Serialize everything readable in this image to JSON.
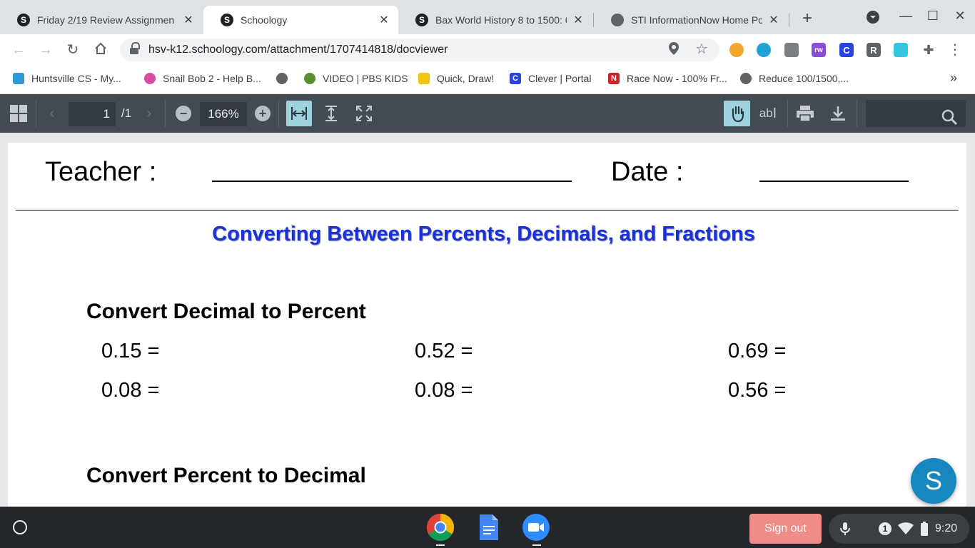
{
  "tabs": [
    {
      "title": "Friday 2/19 Review Assignmen",
      "favicon": "S",
      "active": false
    },
    {
      "title": "Schoology",
      "favicon": "S",
      "active": true
    },
    {
      "title": "Bax World History 8 to 1500: 0",
      "favicon": "S",
      "active": false
    },
    {
      "title": "STI InformationNow Home Por",
      "favicon": "globe",
      "active": false
    }
  ],
  "omnibox": {
    "url": "hsv-k12.schoology.com/attachment/1707414818/docviewer"
  },
  "extensions": [
    {
      "label": "",
      "color": "#f4a52c"
    },
    {
      "label": "",
      "color": "#1ea2d3"
    },
    {
      "label": "",
      "color": "#7b7f84"
    },
    {
      "label": "rw",
      "color": "#8a4fd6"
    },
    {
      "label": "C",
      "color": "#2a44e0"
    },
    {
      "label": "R",
      "color": "#5f6368"
    },
    {
      "label": "",
      "color": "#35c6e0"
    }
  ],
  "bookmarks": [
    {
      "label": "Huntsville CS - My...",
      "icon_color": "#2e9ad6",
      "icon_text": ""
    },
    {
      "label": "Snail Bob 2 - Help B...",
      "icon_color": "#d64ba5",
      "icon_text": ""
    },
    {
      "label": "",
      "icon_color": "#5f6368",
      "icon_text": ""
    },
    {
      "label": "VIDEO | PBS KIDS",
      "icon_color": "#5a8f2b",
      "icon_text": ""
    },
    {
      "label": "Quick, Draw!",
      "icon_color": "#f1c40f",
      "icon_text": ""
    },
    {
      "label": "Clever | Portal",
      "icon_color": "#2a44e0",
      "icon_text": "C"
    },
    {
      "label": "Race Now - 100% Fr...",
      "icon_color": "#d31f26",
      "icon_text": "N"
    },
    {
      "label": "Reduce 100/1500,...",
      "icon_color": "#5f6368",
      "icon_text": ""
    }
  ],
  "bookmarks_overflow": "»",
  "viewer": {
    "page_current": "1",
    "page_total": "/1",
    "zoom": "166%",
    "text_select_label": "ab"
  },
  "document": {
    "teacher_label": "Teacher :",
    "date_label": "Date :",
    "title": "Converting Between Percents, Decimals, and Fractions",
    "section1_heading": "Convert Decimal to Percent",
    "section1_problems": [
      "0.15 =",
      "0.52 =",
      "0.69 =",
      "0.08 =",
      "0.08 =",
      "0.56 ="
    ],
    "section2_heading": "Convert Percent to Decimal"
  },
  "fab_label": "S",
  "shelf": {
    "signout_label": "Sign out",
    "notification_count": "1",
    "time": "9:20"
  }
}
